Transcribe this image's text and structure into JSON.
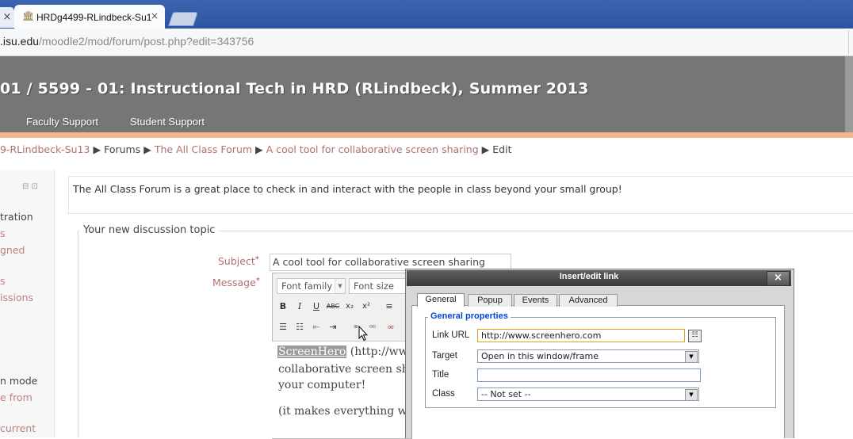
{
  "browser": {
    "prev_tab_close": "×",
    "tab_title": "HRDg4499-RLindbeck-Su1",
    "tab_close": "×",
    "url_host": ".isu.edu",
    "url_path": "/moodle2/mod/forum/post.php?edit=343756"
  },
  "header": {
    "course_title": "01 / 5599 - 01: Instructional Tech in HRD (RLindbeck), Summer 2013",
    "nav": [
      "Faculty Support",
      "Student Support"
    ]
  },
  "breadcrumb": {
    "items": [
      "9-RLindbeck-Su13",
      "Forums",
      "The All Class Forum",
      "A cool tool for collaborative screen sharing",
      "Edit"
    ],
    "separator": "▶"
  },
  "left_block": {
    "controls": "⊟ ⊡",
    "items": [
      "tration",
      "s",
      "gned",
      "s",
      "issions",
      "n mode",
      "e from",
      "current"
    ]
  },
  "forum": {
    "intro": "The All Class Forum is a great place to check in and interact with the people in class beyond your small group!",
    "legend": "Your new discussion topic",
    "subject_label": "Subject",
    "message_label": "Message",
    "required_mark": "*",
    "subject_value": "A cool tool for collaborative screen sharing"
  },
  "editor": {
    "font_family": "Font family",
    "font_size": "Font size",
    "body_highlight": "ScreenHero",
    "body_line1_rest": " (http://www.s",
    "body_line2": "collaborative screen shari",
    "body_line3": "your computer!",
    "body_line4": "(it makes everything work"
  },
  "dialog": {
    "title": "Insert/edit link",
    "close": "×",
    "tabs": [
      "General",
      "Popup",
      "Events",
      "Advanced"
    ],
    "active_tab": "General",
    "group_legend": "General properties",
    "link_url_label": "Link URL",
    "link_url_value": "http://www.screenhero.com",
    "target_label": "Target",
    "target_value": "Open in this window/frame",
    "title_label": "Title",
    "title_value": "",
    "class_label": "Class",
    "class_value": "-- Not set --"
  }
}
